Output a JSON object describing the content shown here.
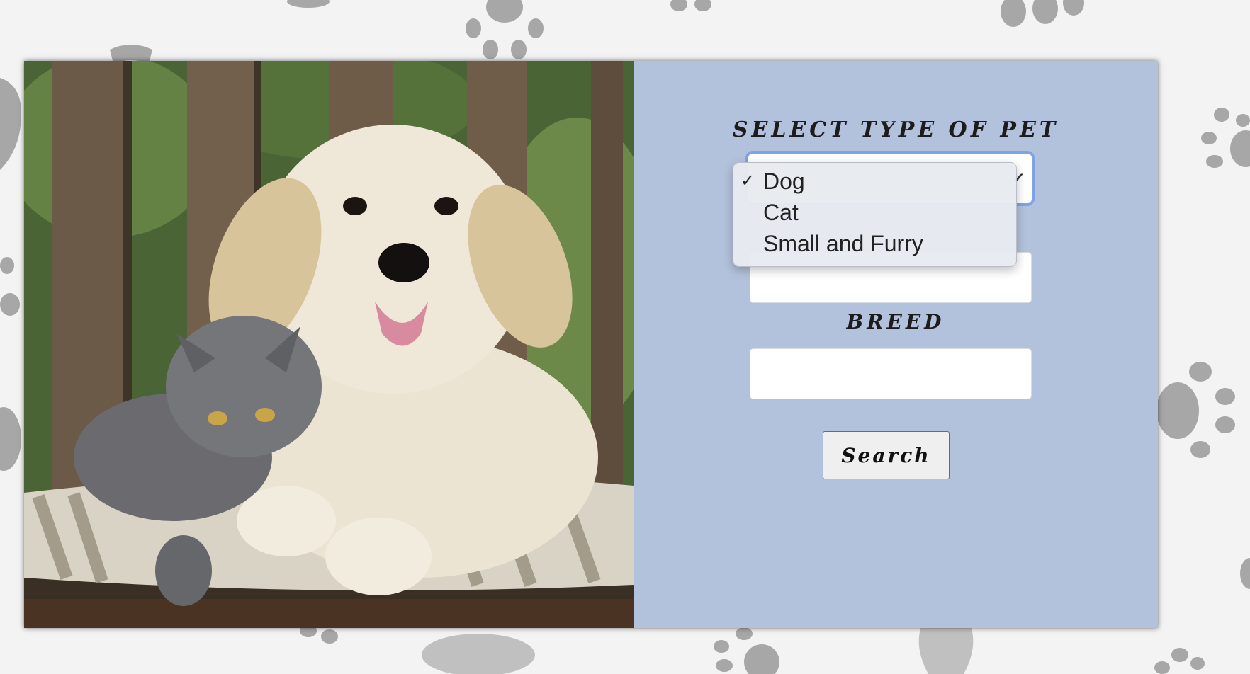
{
  "form": {
    "type_label": "Select type of pet",
    "breed_label": "Breed",
    "search_button": "Search",
    "type_select": {
      "selected": "Dog",
      "options": [
        "Dog",
        "Cat",
        "Small and Furry"
      ]
    },
    "location_value": "",
    "breed_value": ""
  },
  "colors": {
    "page_background": "#f3f3f3",
    "form_panel": "#b3c2dc",
    "paw_prints": "#9a9a9a",
    "select_focus_ring": "#7fa3e6"
  }
}
